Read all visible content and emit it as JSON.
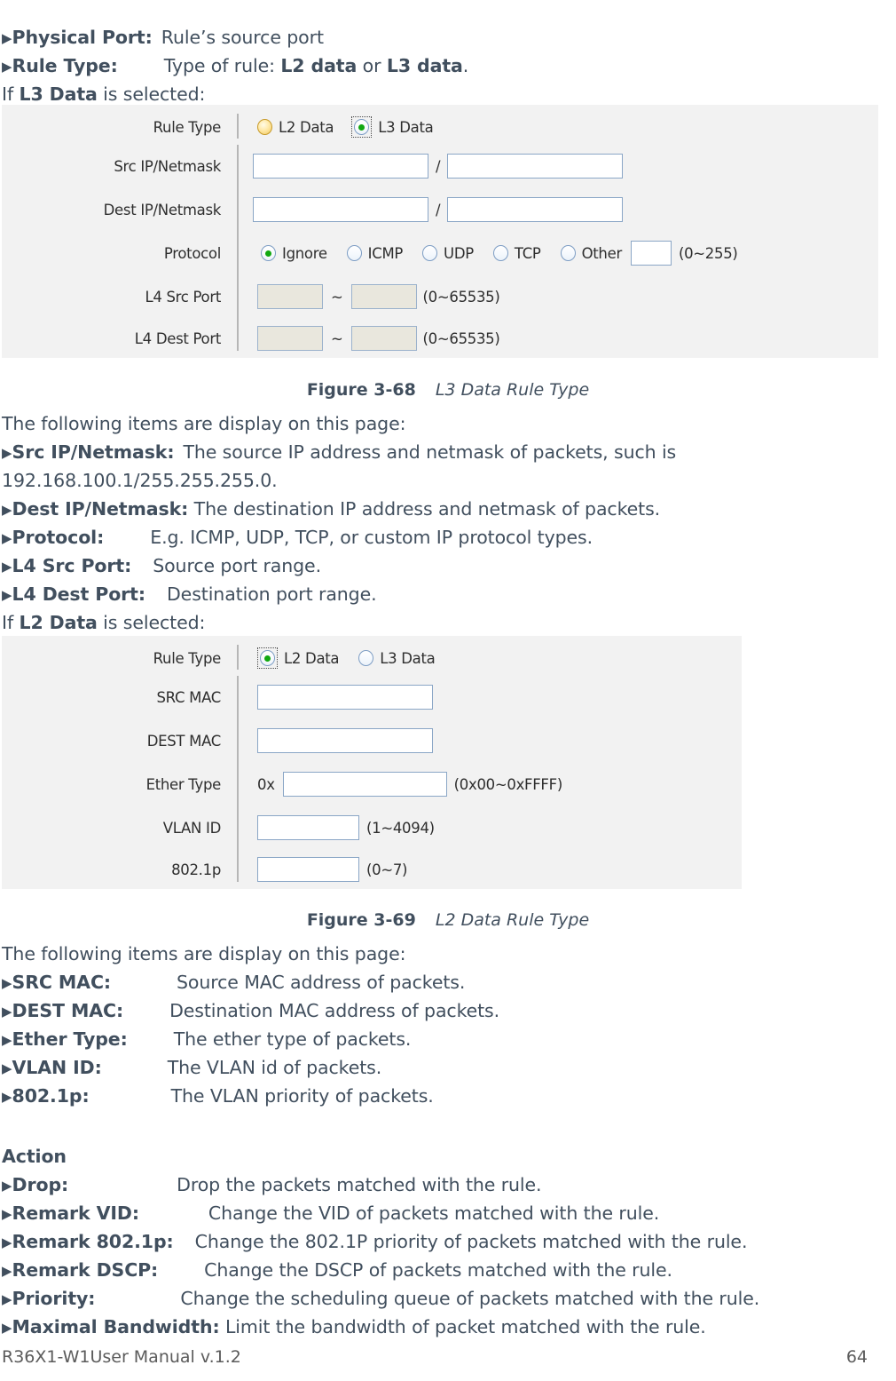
{
  "intro": {
    "physical_port": {
      "triangle": "▶",
      "term": "Physical Port:",
      "desc": "Rule’s source port"
    },
    "rule_type": {
      "triangle": "▶",
      "term": "Rule Type:",
      "desc_a": "Type of rule:",
      "opt_a": "L2 data",
      "conj": "or",
      "opt_b": "L3 data",
      "period": "."
    },
    "if_l3": {
      "pre": "If",
      "bold": "L3 Data",
      "post": "is selected:"
    }
  },
  "figure_l3": {
    "rows": {
      "rule_type": {
        "label": "Rule Type",
        "options": [
          {
            "label": "L2 Data",
            "state": "amber",
            "focused": false
          },
          {
            "label": "L3 Data",
            "state": "on",
            "focused": true
          }
        ]
      },
      "src_ip": {
        "label": "Src IP/Netmask",
        "value_ip": "",
        "separator": "/",
        "value_mask": ""
      },
      "dest_ip": {
        "label": "Dest IP/Netmask",
        "value_ip": "",
        "separator": "/",
        "value_mask": ""
      },
      "protocol": {
        "label": "Protocol",
        "options": [
          {
            "label": "Ignore",
            "state": "on"
          },
          {
            "label": "ICMP",
            "state": "empty"
          },
          {
            "label": "UDP",
            "state": "empty"
          },
          {
            "label": "TCP",
            "state": "empty"
          },
          {
            "label": "Other",
            "state": "empty"
          }
        ],
        "other_value": "",
        "range": "(0~255)"
      },
      "l4_src_port": {
        "label": "L4 Src Port",
        "from": "",
        "tilde": "~",
        "to": "",
        "range": "(0~65535)"
      },
      "l4_dest_port": {
        "label": "L4 Dest Port",
        "from": "",
        "tilde": "~",
        "to": "",
        "range": "(0~65535)"
      }
    }
  },
  "caption_68": {
    "number": "Figure 3-68",
    "title": "L3 Data Rule Type"
  },
  "desc_l3": {
    "lead": "The following items are display on this page:",
    "items": [
      {
        "triangle": "▶",
        "term": "Src IP/Netmask:",
        "desc": "The source IP address and netmask of packets, such is"
      },
      {
        "cont": "192.168.100.1/255.255.255.0."
      },
      {
        "triangle": "▶",
        "term": "Dest IP/Netmask:",
        "desc": "The destination IP address and netmask of packets."
      },
      {
        "triangle": "▶",
        "term": "Protocol:",
        "desc": "E.g. ICMP, UDP, TCP, or custom IP protocol types."
      },
      {
        "triangle": "▶",
        "term": "L4 Src Port:",
        "desc": "Source port range."
      },
      {
        "triangle": "▶",
        "term": "L4 Dest Port:",
        "desc": "Destination port range."
      }
    ],
    "if_l2": {
      "pre": "If",
      "bold": "L2 Data",
      "post": "is selected:"
    }
  },
  "figure_l2": {
    "rows": {
      "rule_type": {
        "label": "Rule Type",
        "options": [
          {
            "label": "L2 Data",
            "state": "on",
            "focused": true
          },
          {
            "label": "L3 Data",
            "state": "empty",
            "focused": false
          }
        ]
      },
      "src_mac": {
        "label": "SRC MAC",
        "value": ""
      },
      "dest_mac": {
        "label": "DEST MAC",
        "value": ""
      },
      "ether_type": {
        "label": "Ether Type",
        "prefix": "0x",
        "value": "",
        "range": "(0x00~0xFFFF)"
      },
      "vlan_id": {
        "label": "VLAN ID",
        "value": "",
        "range": "(1~4094)"
      },
      "dot1p": {
        "label": "802.1p",
        "value": "",
        "range": "(0~7)"
      }
    }
  },
  "caption_69": {
    "number": "Figure 3-69",
    "title": "L2 Data Rule Type"
  },
  "desc_l2": {
    "lead": "The following items are display on this page:",
    "items": [
      {
        "triangle": "▶",
        "term": "SRC MAC:",
        "desc": "Source MAC address of packets."
      },
      {
        "triangle": "▶",
        "term": "DEST MAC:",
        "desc": "Destination MAC address of packets."
      },
      {
        "triangle": "▶",
        "term": "Ether Type:",
        "desc": "The ether type of packets."
      },
      {
        "triangle": "▶",
        "term": "VLAN ID:",
        "desc": "The VLAN id of packets."
      },
      {
        "triangle": "▶",
        "term": "802.1p:",
        "desc": "The VLAN priority of packets."
      }
    ]
  },
  "action": {
    "heading": "Action",
    "items": [
      {
        "triangle": "▶",
        "term": "Drop:",
        "desc": "Drop the packets matched with the rule."
      },
      {
        "triangle": "▶",
        "term": "Remark VID:",
        "desc": "Change the VID of packets matched with the rule."
      },
      {
        "triangle": "▶",
        "term": "Remark 802.1p:",
        "desc": "Change the 802.1P priority of packets matched with the rule."
      },
      {
        "triangle": "▶",
        "term": "Remark DSCP:",
        "desc": "Change the DSCP of packets matched with the rule."
      },
      {
        "triangle": "▶",
        "term": "Priority:",
        "desc": "Change the scheduling queue of packets matched with the rule."
      },
      {
        "triangle": "▶",
        "term": "Maximal Bandwidth:",
        "desc": "Limit the bandwidth of packet matched with the rule."
      }
    ]
  },
  "footer": {
    "left": "R36X1-W1User Manual v.1.2",
    "page": "64"
  },
  "colors": {
    "text": "#414f5e",
    "panel_bg": "#f2f2f2",
    "input_border": "#8aa6c6",
    "disabled_bg": "#e9e7dd",
    "radio_on": "#11a811",
    "radio_amber": "#f0c860"
  }
}
